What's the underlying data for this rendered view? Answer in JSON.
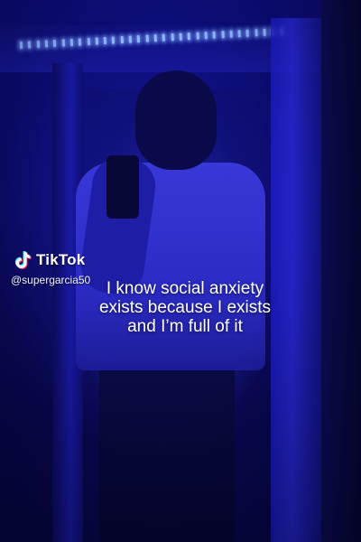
{
  "watermark": {
    "brand": "TikTok",
    "handle": "@supergarcia50",
    "icon": "tiktok-logo-icon"
  },
  "caption": {
    "lines": [
      "I know social anxiety",
      "exists because I exists",
      "and I’m full of it"
    ]
  },
  "colors": {
    "ambient_light": "#1a1ac8",
    "led_glow": "#8fb6ff",
    "text": "#ffffff"
  }
}
